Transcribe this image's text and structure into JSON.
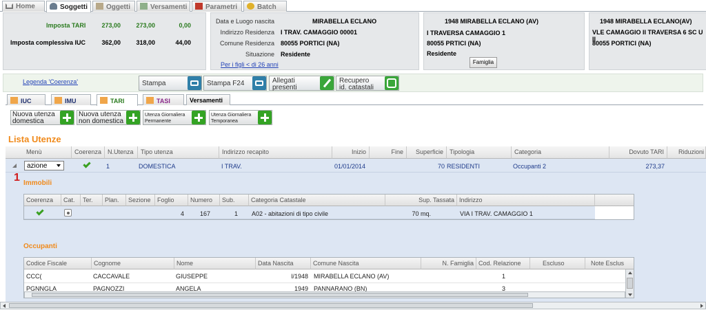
{
  "nav": {
    "tabs": [
      {
        "label": "Home",
        "icon": "home-icon"
      },
      {
        "label": "Soggetti",
        "icon": "person-icon"
      },
      {
        "label": "Oggetti",
        "icon": "building-icon"
      },
      {
        "label": "Versamenti",
        "icon": "money-icon"
      },
      {
        "label": "Parametri",
        "icon": "parameters-icon"
      },
      {
        "label": "Batch",
        "icon": "batch-icon"
      }
    ],
    "active": "Soggetti"
  },
  "taxes": {
    "rows": [
      {
        "label": "Imposta TARI",
        "v1": "273,00",
        "v2": "273,00",
        "v3": "0,00"
      },
      {
        "label": "Imposta complessiva IUC",
        "v1": "362,00",
        "v2": "318,00",
        "v3": "44,00"
      }
    ]
  },
  "subject": {
    "fields": [
      {
        "label": "Data e Luogo nascita",
        "value": "MIRABELLA ECLANO"
      },
      {
        "label": "Indirizzo Residenza",
        "value": "I TRAV. CAMAGGIO 00001"
      },
      {
        "label": "Comune Residenza",
        "value": "80055 PORTICI (NA)"
      },
      {
        "label": "Situazione",
        "value": "Residente"
      }
    ],
    "link": "Per i figli < di 26 anni"
  },
  "panel3": {
    "line1": "1948 MIRABELLA ECLANO (AV)",
    "line2": "I TRAVERSA CAMAGGIO 1",
    "line3": "80055 PRTICI (NA)",
    "line4": "Residente",
    "button": "Famiglia"
  },
  "panel4": {
    "line1": "1948 MIRABELLA ECLANO(AV)",
    "line2": "VLE CAMAGGIO II TRAVERSA 6 SC U II",
    "line3": "80055 PORTICI (NA)"
  },
  "toolbar": {
    "legend": "Legenda 'Coerenza'",
    "stampa": "Stampa",
    "stampa_f24": "Stampa F24",
    "allegati": [
      "Allegati",
      "presenti"
    ],
    "recupero": [
      "Recupero",
      "id. catastali"
    ]
  },
  "subtabs": [
    "IUC",
    "IMU",
    "TARI",
    "TASI",
    "Versamenti"
  ],
  "actions": [
    {
      "lines": [
        "Nuova utenza",
        "domestica"
      ]
    },
    {
      "lines": [
        "Nuova utenza",
        "non domestica"
      ]
    },
    {
      "lines": [
        "Utenza Giornaliera",
        "Permanente"
      ]
    },
    {
      "lines": [
        "Utenza Giornaliera",
        "Temporanea"
      ]
    }
  ],
  "lista": {
    "title": "Lista Utenze",
    "headers": [
      "Menù",
      "Coerenza",
      "N.Utenza",
      "Tipo utenza",
      "Indirizzo recapito",
      "Inizio",
      "Fine",
      "Superficie",
      "Tipologia",
      "Categoria",
      "Dovuto TARI",
      "Riduzioni"
    ],
    "row": {
      "menu": "azione",
      "n": "1",
      "tipo": "DOMESTICA",
      "indirizzo": "I TRAV.",
      "inizio": "01/01/2014",
      "superficie": "70",
      "tipologia": "RESIDENTI",
      "categoria": "Occupanti 2",
      "dovuto": "273,37"
    },
    "marker": "1"
  },
  "immobili": {
    "title": "Immobili",
    "headers": [
      "Coerenza",
      "Cat.",
      "Ter.",
      "Plan.",
      "Sezione",
      "Foglio",
      "Numero",
      "Sub.",
      "Categoria Catastale",
      "Sup. Tassata",
      "Indirizzo"
    ],
    "row": {
      "foglio": "4",
      "numero": "167",
      "sub": "1",
      "categoria": "A02 - abitazioni di tipo civile",
      "sup": "70 mq.",
      "indirizzo": "VIA I TRAV. CAMAGGIO 1"
    }
  },
  "occupanti": {
    "title": "Occupanti",
    "headers": [
      "Codice Fiscale",
      "Cognome",
      "Nome",
      "Data Nascita",
      "Comune Nascita",
      "N. Famiglia",
      "Cod. Relazione",
      "Escluso",
      "Note Esclus"
    ],
    "rows": [
      {
        "cf": "CCC(",
        "cognome": "CACCAVALE",
        "nome": "GIUSEPPE",
        "data": "l/1948",
        "comune": "MIRABELLA ECLANO (AV)",
        "rel": "1"
      },
      {
        "cf": "PGNNGLA",
        "cognome": "PAGNOZZI",
        "nome": "ANGELA",
        "data": "1949",
        "comune": "PANNARANO (BN)",
        "rel": "3"
      }
    ]
  },
  "colors": {
    "accent_orange": "#f08a1b",
    "green": "#3aa021",
    "blue_text": "#1d3a8a",
    "grid_bg": "#dde6f3"
  }
}
